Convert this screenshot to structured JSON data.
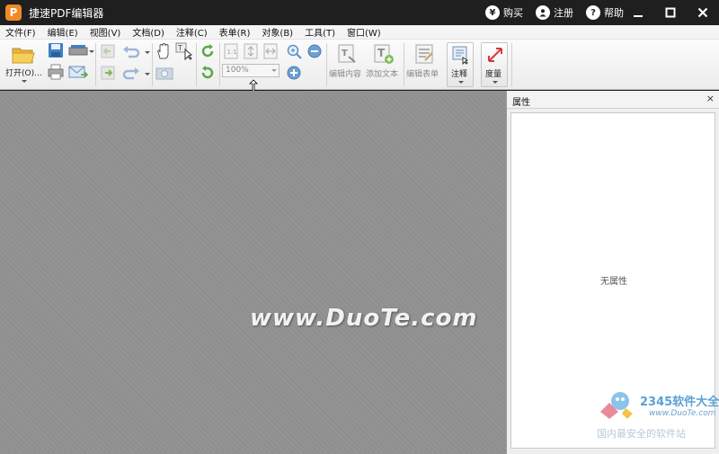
{
  "app": {
    "logo_letter": "P",
    "title": "捷速PDF编辑器"
  },
  "titlebar": {
    "buy_icon_glyph": "¥",
    "buy_label": "购买",
    "register_label": "注册",
    "help_icon_glyph": "?",
    "help_label": "帮助",
    "minimize_glyph": "▁",
    "maximize_glyph": "☐",
    "close_glyph": "✕"
  },
  "menu": [
    "文件(F)",
    "编辑(E)",
    "视图(V)",
    "文档(D)",
    "注释(C)",
    "表单(R)",
    "对象(B)",
    "工具(T)",
    "窗口(W)"
  ],
  "toolbar": {
    "open_label": "打开(O)...",
    "zoom_value": "100%",
    "edit_content_label": "编辑内容",
    "add_text_label": "添加文本",
    "edit_form_label": "编辑表单",
    "annotate_label": "注释",
    "measure_label": "度量"
  },
  "watermark": "www.DuoTe.com",
  "props_panel": {
    "title": "属性",
    "close_glyph": "×",
    "empty_text": "无属性"
  },
  "brand": {
    "title": "2345软件大全",
    "url": "www.DuoTe.com",
    "slogan": "国内最安全的软件站"
  },
  "colors": {
    "titlebar_bg": "#1f1f1f",
    "logo_orange": "#f08a24",
    "workspace_bg": "#909090",
    "toolbar_bg": "#f0f0f0"
  }
}
